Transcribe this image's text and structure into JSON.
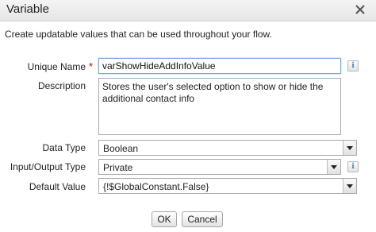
{
  "dialog": {
    "title": "Variable",
    "intro": "Create updatable values that can be used throughout your flow."
  },
  "form": {
    "unique_name": {
      "label": "Unique Name",
      "value": "varShowHideAddInfoValue",
      "required_mark": "*"
    },
    "description": {
      "label": "Description",
      "value": "Stores the user's selected option to show or hide the additional contact info"
    },
    "data_type": {
      "label": "Data Type",
      "value": "Boolean"
    },
    "io_type": {
      "label": "Input/Output Type",
      "value": "Private"
    },
    "default_value": {
      "label": "Default Value",
      "value": "{!$GlobalConstant.False}"
    },
    "info_glyph": "i"
  },
  "buttons": {
    "ok": "OK",
    "cancel": "Cancel"
  },
  "icons": {
    "close": "close-icon",
    "info": "info-icon",
    "dropdown": "chevron-down-icon"
  }
}
